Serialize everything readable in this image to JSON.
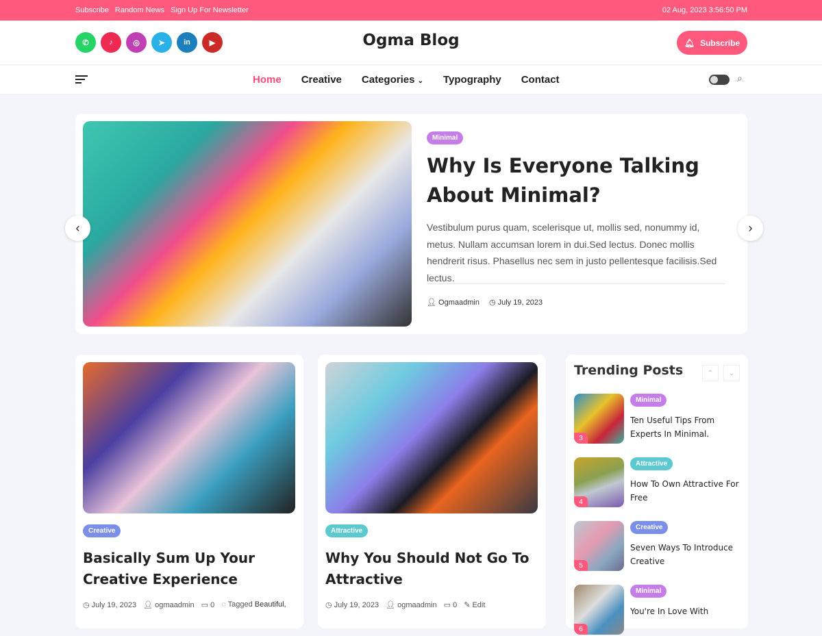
{
  "topbar": {
    "links": [
      "Subscribe",
      "Random News",
      "Sign Up For Newsletter"
    ],
    "datetime": "02 Aug, 2023 3:56:50 PM"
  },
  "header": {
    "site_title": "Ogma Blog",
    "subscribe_label": "Subscribe",
    "socials": [
      {
        "name": "whatsapp",
        "color": "#25d366",
        "glyph": "✆"
      },
      {
        "name": "tiktok",
        "color": "#ee2a52",
        "glyph": "♪"
      },
      {
        "name": "instagram",
        "color": "#c13fb5",
        "glyph": "◎"
      },
      {
        "name": "telegram",
        "color": "#2ab1e8",
        "glyph": "➤"
      },
      {
        "name": "linkedin",
        "color": "#1a7fba",
        "glyph": "in"
      },
      {
        "name": "youtube",
        "color": "#cc2a26",
        "glyph": "▶"
      }
    ]
  },
  "nav": {
    "items": [
      "Home",
      "Creative",
      "Categories",
      "Typography",
      "Contact"
    ]
  },
  "colors": {
    "accent": "#ff5a7e",
    "minimal": "#c57ee8",
    "creative": "#7b8ee8",
    "attractive": "#5cc8d0"
  },
  "hero": {
    "category": "Minimal",
    "title": "Why Is Everyone Talking About Minimal?",
    "excerpt": "Vestibulum purus quam, scelerisque ut, mollis sed, nonummy id, metus. Nullam accumsan lorem in dui.Sed lectus. Donec mollis hendrerit risus. Phasellus nec sem in justo pellentesque facilisis.Sed lectus.",
    "author": "Ogmaadmin",
    "date": "July 19, 2023"
  },
  "cards": [
    {
      "category": "Creative",
      "title": "Basically Sum Up Your Creative Experience",
      "date": "July 19, 2023",
      "author": "ogmaadmin",
      "comments": "0",
      "tagged": "Tagged",
      "tags": "Beautiful,"
    },
    {
      "category": "Attractive",
      "title": "Why You Should Not Go To Attractive",
      "date": "July 19, 2023",
      "author": "ogmaadmin",
      "comments": "0",
      "edit": "Edit"
    }
  ],
  "trending": {
    "title": "Trending Posts",
    "items": [
      {
        "num": "3",
        "category": "Minimal",
        "title": "Ten Useful Tips From Experts In Minimal."
      },
      {
        "num": "4",
        "category": "Attractive",
        "title": "How To Own Attractive For Free"
      },
      {
        "num": "5",
        "category": "Creative",
        "title": "Seven Ways To Introduce Creative"
      },
      {
        "num": "6",
        "category": "Minimal",
        "title": "You're In Love With"
      }
    ]
  }
}
